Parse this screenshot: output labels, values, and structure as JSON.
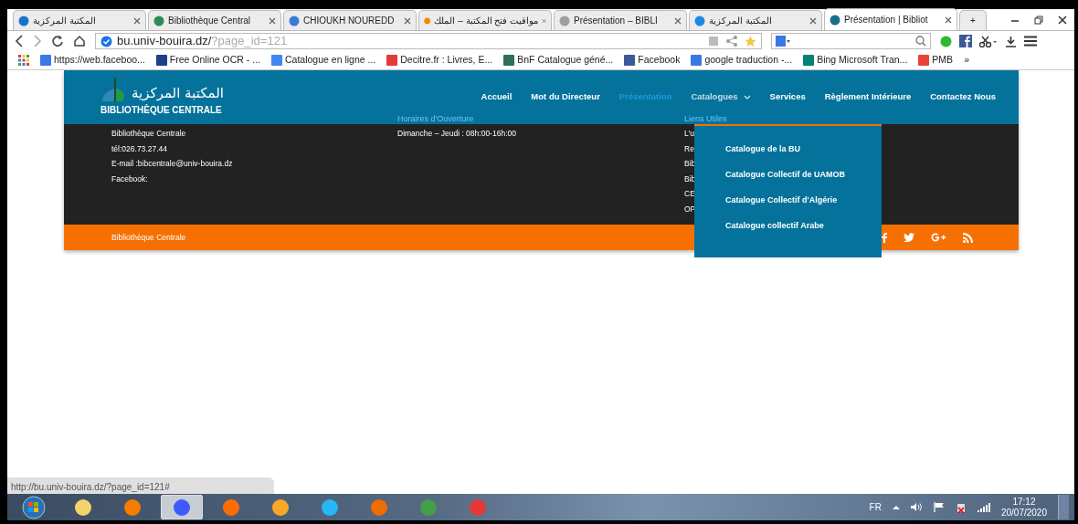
{
  "browser": {
    "tabs": [
      {
        "title": "المكتبة المركزية",
        "selected": false,
        "color": "#1a73c8"
      },
      {
        "title": "Bibliothèque Central",
        "selected": false,
        "color": "#2e8b57"
      },
      {
        "title": "CHIOUKH NOUREDD",
        "selected": false,
        "color": "#3a7bd5"
      },
      {
        "title": "مواقيت فتح المكتبة – الملك",
        "selected": false,
        "color": "#f08c00"
      },
      {
        "title": "Présentation – BIBLI",
        "selected": false,
        "color": "#9e9e9e"
      },
      {
        "title": "المكتبة المركزية",
        "selected": false,
        "color": "#1e88e5"
      },
      {
        "title": "Présentation | Bibliot",
        "selected": true,
        "color": "#1b6e8a"
      }
    ],
    "new_tab": "+",
    "address": {
      "host": "bu.univ-bouira.dz/",
      "path": "?page_id=121"
    },
    "bookmarks": [
      {
        "label": "https://web.faceboo...",
        "color": "#3b78e7"
      },
      {
        "label": "Free Online OCR - ...",
        "color": "#1f3f8a"
      },
      {
        "label": "Catalogue en ligne ...",
        "color": "#4285f4"
      },
      {
        "label": "Decitre.fr : Livres, E...",
        "color": "#e53935"
      },
      {
        "label": "BnF Catalogue géné...",
        "color": "#2f6e5a"
      },
      {
        "label": "Facebook",
        "color": "#3b5998"
      },
      {
        "label": "google traduction -...",
        "color": "#3b78e7"
      },
      {
        "label": "Bing Microsoft Tran...",
        "color": "#008373"
      },
      {
        "label": "PMB",
        "color": "#ea4335"
      }
    ],
    "more": "»"
  },
  "site": {
    "logo": {
      "arabic": "المكتبة المركزية",
      "latin": "BIBLIOTHÈQUE CENTRALE"
    },
    "nav": [
      {
        "label": "Accueil",
        "selected": false,
        "dropdown": false
      },
      {
        "label": "Mot du Directeur",
        "selected": false,
        "dropdown": false
      },
      {
        "label": "Présentation",
        "selected": true,
        "dropdown": false
      },
      {
        "label": "Catalogues",
        "selected": false,
        "dropdown": true
      },
      {
        "label": "Services",
        "selected": false,
        "dropdown": false
      },
      {
        "label": "Règlement Intérieure",
        "selected": false,
        "dropdown": false
      },
      {
        "label": "Contactez Nous",
        "selected": false,
        "dropdown": false
      }
    ],
    "contact": [
      "Bibliothèque Centrale",
      "tél:026.73.27.44",
      "E-mail :bibcentrale@univ-bouira.dz",
      "Facebook:"
    ],
    "hours": {
      "heading": "Horaires d'Ouverture",
      "text": "Dimanche – Jeudi : 08h:00-16h:00"
    },
    "links": {
      "heading": "Liens Utiles",
      "items": [
        "L'u",
        "Re",
        "Bib",
        "Bib",
        "CE",
        "OP"
      ]
    },
    "bottom_text": "Bibliothèque Centrale",
    "dropdown_items": [
      "Catalogue de la BU",
      "Catalogue Collectif de UAMOB",
      "Catalogue Collectif d'Algérie",
      "Catalogue collectif Arabe"
    ]
  },
  "status_url": "http://bu.univ-bouira.dz/?page_id=121#",
  "taskbar": {
    "apps": [
      {
        "selected": false,
        "color": "#f3d36b"
      },
      {
        "selected": false,
        "color": "#f57c00"
      },
      {
        "selected": true,
        "color": "#3d5afe"
      },
      {
        "selected": false,
        "color": "#ff6d00"
      },
      {
        "selected": false,
        "color": "#f9a825"
      },
      {
        "selected": false,
        "color": "#29b6f6"
      },
      {
        "selected": false,
        "color": "#ef6c00"
      },
      {
        "selected": false,
        "color": "#43a047"
      },
      {
        "selected": false,
        "color": "#e53935"
      }
    ],
    "language": "FR",
    "time": "17:12",
    "date": "20/07/2020"
  }
}
